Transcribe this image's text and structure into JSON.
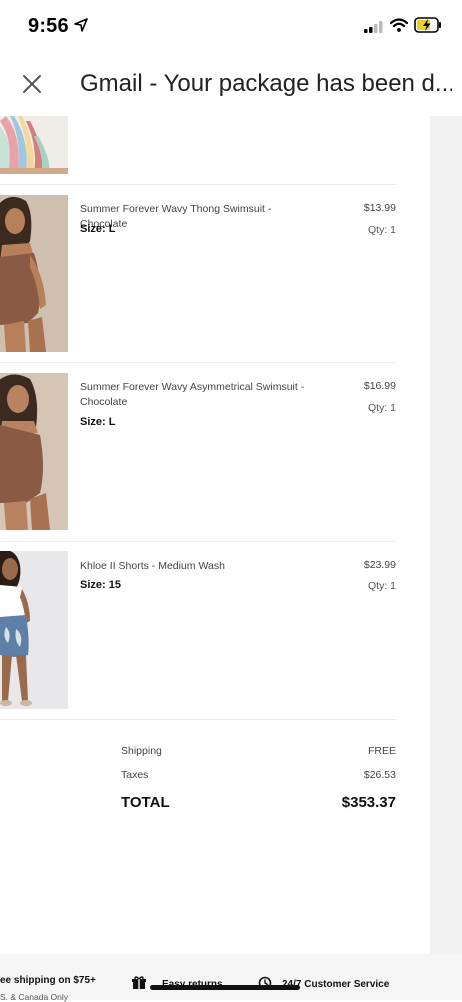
{
  "status_bar": {
    "time": "9:56"
  },
  "app_bar": {
    "title": "Gmail - Your package has been d..."
  },
  "items": [
    {
      "name": "Summer Forever Wavy Thong Swimsuit - Chocolate",
      "size": "Size: L",
      "price": "$13.99",
      "qty": "Qty: 1"
    },
    {
      "name": "Summer Forever Wavy Asymmetrical Swimsuit - Chocolate",
      "size": "Size: L",
      "price": "$16.99",
      "qty": "Qty: 1"
    },
    {
      "name": "Khloe II Shorts - Medium Wash",
      "size": "Size: 15",
      "price": "$23.99",
      "qty": "Qty: 1"
    }
  ],
  "summary": {
    "shipping_label": "Shipping",
    "shipping_value": "FREE",
    "taxes_label": "Taxes",
    "taxes_value": "$26.53",
    "total_label": "TOTAL",
    "total_value": "$353.37"
  },
  "footer": {
    "free_shipping": "ee shipping on $75+",
    "free_shipping_sub": "S. & Canada Only",
    "easy_returns": "Easy returns",
    "customer_service": "24/7 Customer Service"
  },
  "colors": {
    "swimsuit": "#8a5a45",
    "denim": "#5d7fa8",
    "divider": "#ececec"
  }
}
